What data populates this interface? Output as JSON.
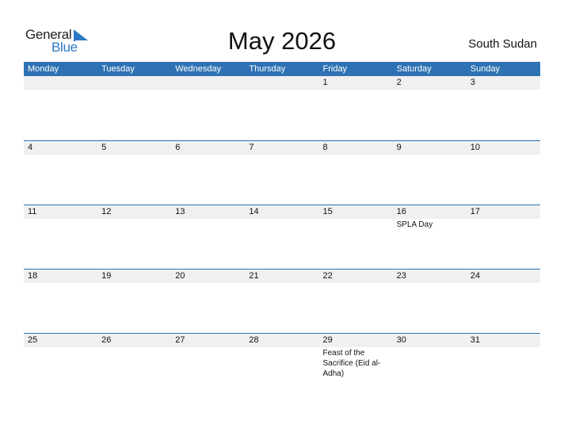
{
  "logo": {
    "line1": "General",
    "line2": "Blue",
    "brand_color": "#2b78c5"
  },
  "title": "May 2026",
  "country": "South Sudan",
  "colors": {
    "header_bg": "#2e72b3",
    "date_strip_bg": "#f0f0f0"
  },
  "weekdays": [
    "Monday",
    "Tuesday",
    "Wednesday",
    "Thursday",
    "Friday",
    "Saturday",
    "Sunday"
  ],
  "weeks": [
    {
      "days": [
        {
          "date": ""
        },
        {
          "date": ""
        },
        {
          "date": ""
        },
        {
          "date": ""
        },
        {
          "date": "1"
        },
        {
          "date": "2"
        },
        {
          "date": "3"
        }
      ]
    },
    {
      "days": [
        {
          "date": "4"
        },
        {
          "date": "5"
        },
        {
          "date": "6"
        },
        {
          "date": "7"
        },
        {
          "date": "8"
        },
        {
          "date": "9"
        },
        {
          "date": "10"
        }
      ]
    },
    {
      "days": [
        {
          "date": "11"
        },
        {
          "date": "12"
        },
        {
          "date": "13"
        },
        {
          "date": "14"
        },
        {
          "date": "15"
        },
        {
          "date": "16",
          "event": "SPLA Day"
        },
        {
          "date": "17"
        }
      ]
    },
    {
      "days": [
        {
          "date": "18"
        },
        {
          "date": "19"
        },
        {
          "date": "20"
        },
        {
          "date": "21"
        },
        {
          "date": "22"
        },
        {
          "date": "23"
        },
        {
          "date": "24"
        }
      ]
    },
    {
      "days": [
        {
          "date": "25"
        },
        {
          "date": "26"
        },
        {
          "date": "27"
        },
        {
          "date": "28"
        },
        {
          "date": "29",
          "event": "Feast of the Sacrifice (Eid al-Adha)"
        },
        {
          "date": "30"
        },
        {
          "date": "31"
        }
      ]
    }
  ]
}
